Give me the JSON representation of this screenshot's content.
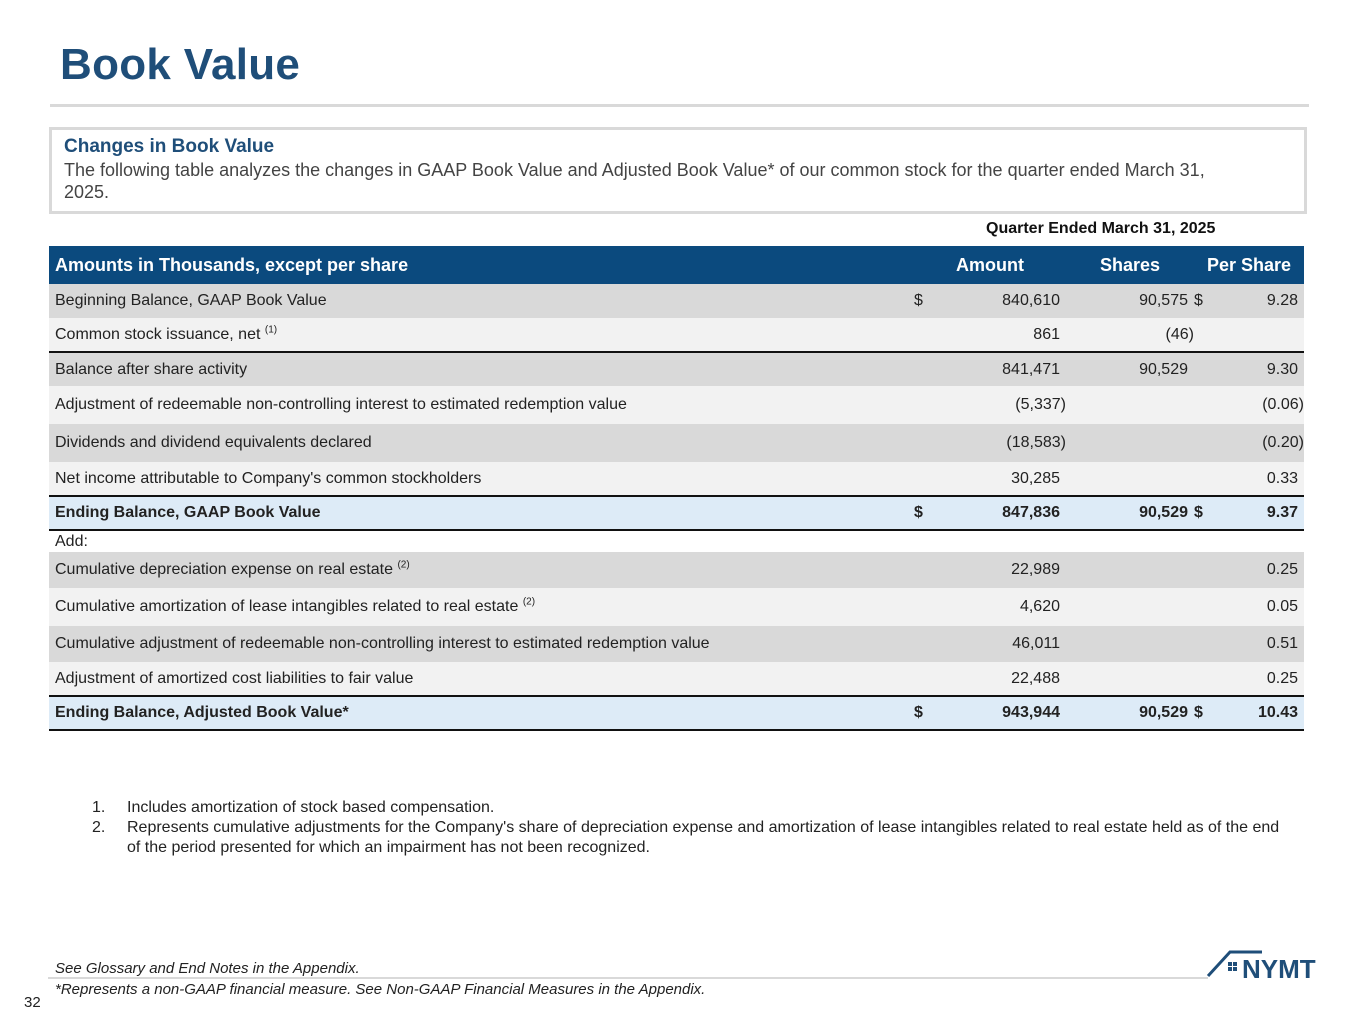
{
  "page": {
    "title": "Book Value",
    "page_number": "32"
  },
  "intro": {
    "heading": "Changes in Book Value",
    "text": "The following table analyzes the changes in GAAP Book Value and Adjusted Book Value* of our common stock for the quarter ended March 31, 2025."
  },
  "table": {
    "period_header": "Quarter Ended March 31, 2025",
    "headers": {
      "label": "Amounts in Thousands, except per share",
      "amount": "Amount",
      "shares": "Shares",
      "per_share": "Per Share"
    },
    "rows": [
      {
        "label": "Beginning Balance, GAAP Book Value",
        "sup": "",
        "cur1": "$",
        "amount": "840,610",
        "shares": "90,575",
        "cur2": "$",
        "per_share": "9.28"
      },
      {
        "label": "Common stock issuance, net",
        "sup": "(1)",
        "cur1": "",
        "amount": "861",
        "shares": "(46)",
        "cur2": "",
        "per_share": ""
      },
      {
        "label": "Balance after share activity",
        "sup": "",
        "cur1": "",
        "amount": "841,471",
        "shares": "90,529",
        "cur2": "",
        "per_share": "9.30"
      },
      {
        "label": "Adjustment of redeemable non-controlling interest to estimated redemption value",
        "sup": "",
        "cur1": "",
        "amount": "(5,337)",
        "shares": "",
        "cur2": "",
        "per_share": "(0.06)"
      },
      {
        "label": "Dividends and dividend equivalents declared",
        "sup": "",
        "cur1": "",
        "amount": "(18,583)",
        "shares": "",
        "cur2": "",
        "per_share": "(0.20)"
      },
      {
        "label": "Net income attributable to Company's common stockholders",
        "sup": "",
        "cur1": "",
        "amount": "30,285",
        "shares": "",
        "cur2": "",
        "per_share": "0.33"
      },
      {
        "label": "Ending Balance, GAAP Book Value",
        "sup": "",
        "cur1": "$",
        "amount": "847,836",
        "shares": "90,529",
        "cur2": "$",
        "per_share": "9.37"
      },
      {
        "label": "Add:",
        "sup": "",
        "cur1": "",
        "amount": "",
        "shares": "",
        "cur2": "",
        "per_share": ""
      },
      {
        "label": "Cumulative depreciation expense on real estate",
        "sup": "(2)",
        "cur1": "",
        "amount": "22,989",
        "shares": "",
        "cur2": "",
        "per_share": "0.25"
      },
      {
        "label": "Cumulative amortization of lease intangibles related to real estate",
        "sup": "(2)",
        "cur1": "",
        "amount": "4,620",
        "shares": "",
        "cur2": "",
        "per_share": "0.05"
      },
      {
        "label": "Cumulative adjustment of redeemable non-controlling interest to estimated redemption value",
        "sup": "",
        "cur1": "",
        "amount": "46,011",
        "shares": "",
        "cur2": "",
        "per_share": "0.51"
      },
      {
        "label": "Adjustment of amortized cost liabilities to fair value",
        "sup": "",
        "cur1": "",
        "amount": "22,488",
        "shares": "",
        "cur2": "",
        "per_share": "0.25"
      },
      {
        "label": "Ending Balance, Adjusted Book Value*",
        "sup": "",
        "cur1": "$",
        "amount": "943,944",
        "shares": "90,529",
        "cur2": "$",
        "per_share": "10.43"
      }
    ]
  },
  "footnotes": [
    {
      "num": "1.",
      "text": "Includes amortization of stock based compensation."
    },
    {
      "num": "2.",
      "text": "Represents cumulative adjustments for the Company's share of depreciation expense and amortization of lease intangibles related to real estate held as of the end of the period presented for which an impairment has not been recognized."
    }
  ],
  "bottom": {
    "note1": "See Glossary and End Notes in the Appendix.",
    "note2": "*Represents a non-GAAP financial measure. See Non-GAAP Financial Measures in the Appendix."
  },
  "logo": {
    "text": "NYMT",
    "color": "#1f4e79"
  }
}
